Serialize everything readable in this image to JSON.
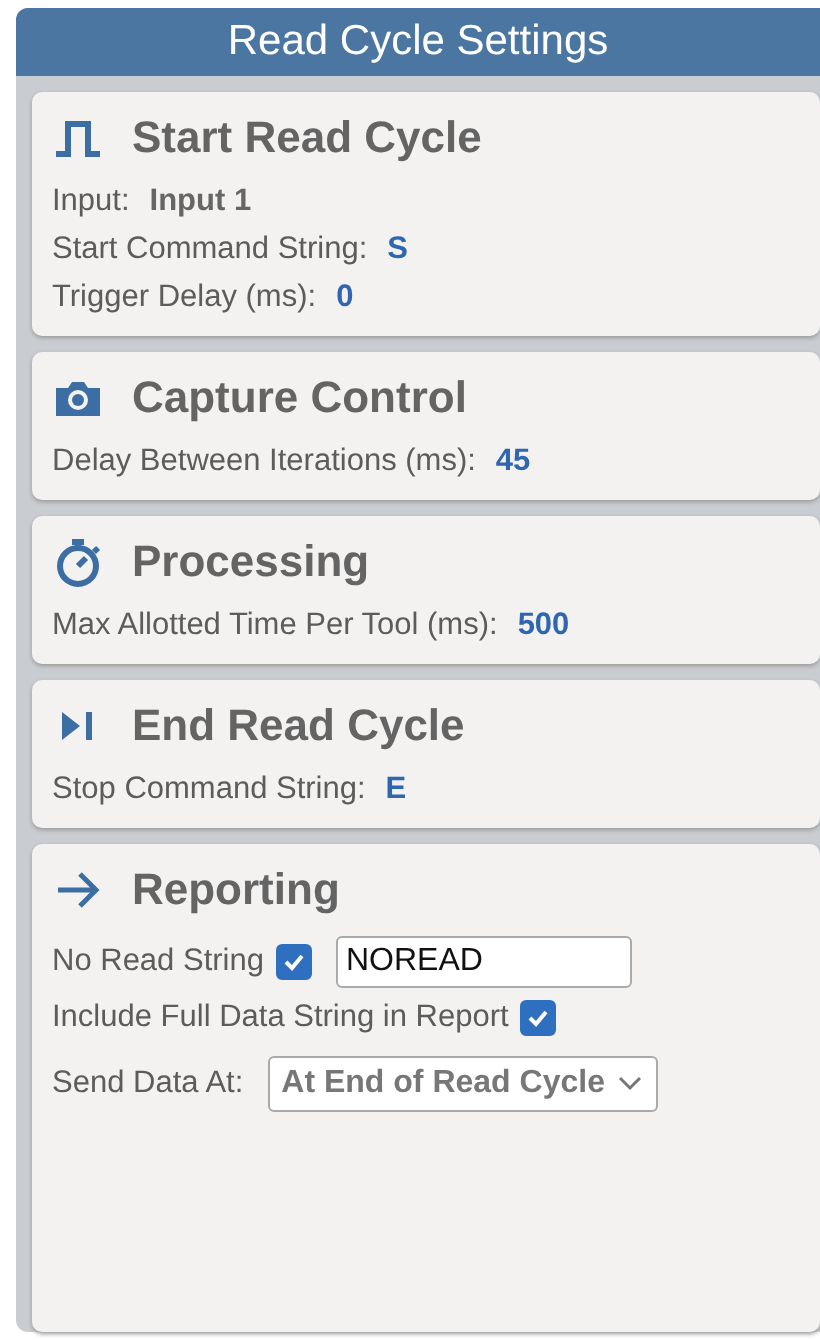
{
  "title": "Read Cycle Settings",
  "sections": [
    {
      "title": "Start Read Cycle",
      "rows": [
        {
          "kind": "value",
          "label": "Input:",
          "value": "Input 1",
          "accent": false
        },
        {
          "kind": "value",
          "label": "Start Command String:",
          "value": "S",
          "accent": true
        },
        {
          "kind": "value",
          "label": "Trigger Delay (ms):",
          "value": "0",
          "accent": true
        }
      ]
    },
    {
      "title": "Capture Control",
      "rows": [
        {
          "kind": "value",
          "label": "Delay Between Iterations (ms):",
          "value": "45",
          "accent": true
        }
      ]
    },
    {
      "title": "Processing",
      "rows": [
        {
          "kind": "value",
          "label": "Max Allotted Time Per Tool (ms):",
          "value": "500",
          "accent": true
        }
      ]
    },
    {
      "title": "End Read Cycle",
      "rows": [
        {
          "kind": "value",
          "label": "Stop Command String:",
          "value": "E",
          "accent": true
        }
      ]
    },
    {
      "title": "Reporting",
      "rows": [
        {
          "kind": "check-input",
          "label": "No Read String",
          "checked": true,
          "value": "NOREAD"
        },
        {
          "kind": "check",
          "label": "Include Full Data String in Report",
          "checked": true
        },
        {
          "kind": "select",
          "label": "Send Data At:",
          "value": "At End of Read Cycle"
        }
      ]
    }
  ]
}
